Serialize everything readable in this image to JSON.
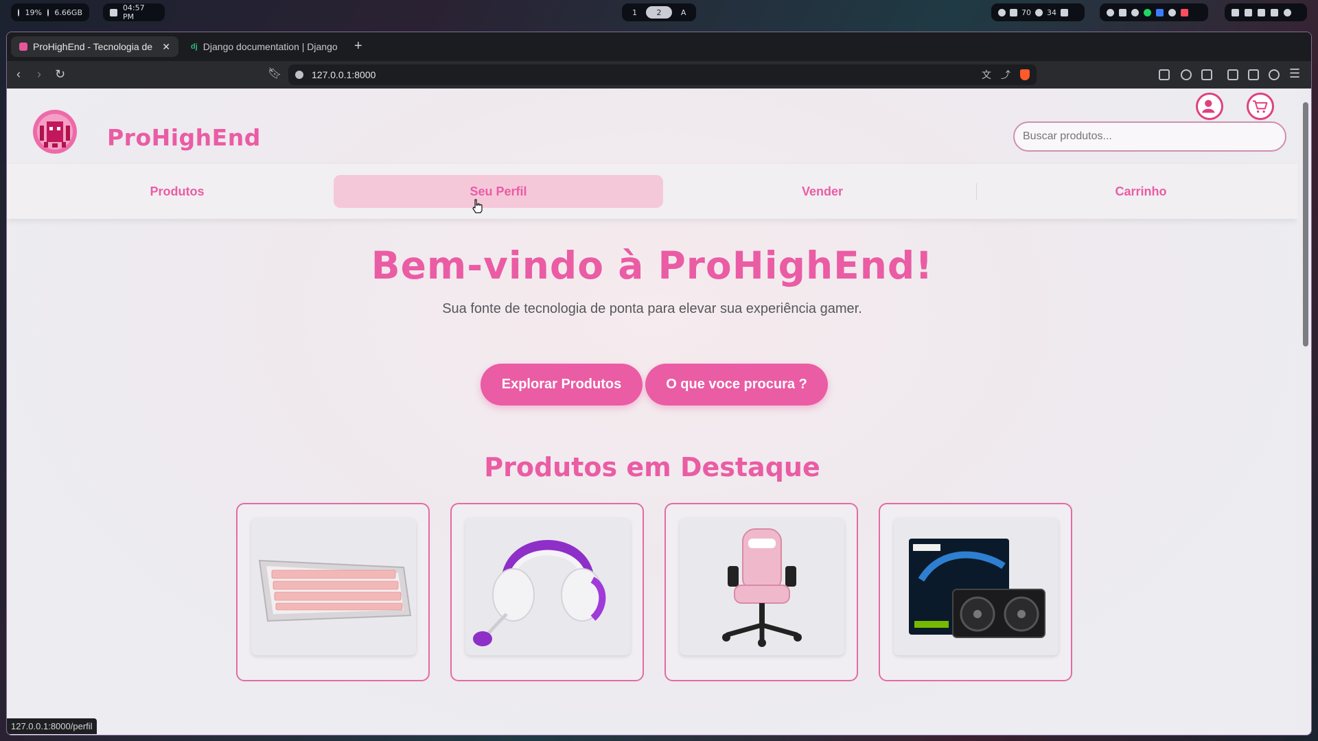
{
  "system_bar": {
    "cpu": "19%",
    "mem": "6.66GB",
    "time": "04:57 PM",
    "workspaces": [
      "1",
      "2"
    ],
    "active_workspace": "2",
    "ws_extra": "A",
    "volume": "70",
    "brightness": "34"
  },
  "browser": {
    "tabs": [
      {
        "title": "ProHighEnd - Tecnologia de",
        "favicon": "prohighend-icon"
      },
      {
        "title": "Django documentation | Django",
        "favicon": "django-icon"
      }
    ],
    "url": "127.0.0.1:8000",
    "status_url": "127.0.0.1:8000/perfil"
  },
  "site": {
    "brand": "ProHighEnd",
    "search_placeholder": "Buscar produtos...",
    "nav": [
      {
        "label": "Produtos"
      },
      {
        "label": "Seu Perfil"
      },
      {
        "label": "Vender"
      },
      {
        "label": "Carrinho"
      }
    ],
    "hero": {
      "title": "Bem-vindo à ProHighEnd!",
      "subtitle": "Sua fonte de tecnologia de ponta para elevar sua experiência gamer.",
      "primary_button": "Explorar Produtos",
      "secondary_button": "O que voce procura ?"
    },
    "featured_title": "Produtos em Destaque",
    "products": [
      {
        "image": "pink-white-mechanical-keyboard"
      },
      {
        "image": "white-purple-gaming-headset"
      },
      {
        "image": "pink-gaming-chair"
      },
      {
        "image": "palit-graphics-card"
      }
    ],
    "colors": {
      "accent": "#ea5ca4",
      "nav_active": "#f5c8d9"
    }
  }
}
